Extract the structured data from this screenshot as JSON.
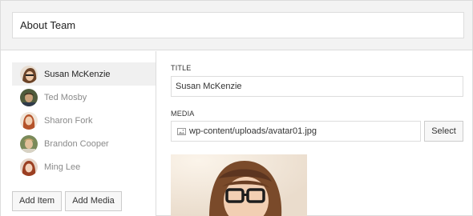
{
  "header": {
    "title_value": "About Team"
  },
  "sidebar": {
    "items": [
      {
        "label": "Susan McKenzie",
        "selected": true
      },
      {
        "label": "Ted Mosby",
        "selected": false
      },
      {
        "label": "Sharon Fork",
        "selected": false
      },
      {
        "label": "Brandon Cooper",
        "selected": false
      },
      {
        "label": "Ming Lee",
        "selected": false
      }
    ],
    "add_item_label": "Add Item",
    "add_media_label": "Add Media"
  },
  "form": {
    "title_label": "TITLE",
    "title_value": "Susan McKenzie",
    "media_label": "MEDIA",
    "media_value": "wp-content/uploads/avatar01.jpg",
    "select_label": "Select"
  },
  "colors": {
    "header_bg": "#f3f3f3",
    "selected_row_bg": "#f0f0f0",
    "border": "#dcdcdc"
  },
  "icons": {
    "media": "image-icon"
  }
}
